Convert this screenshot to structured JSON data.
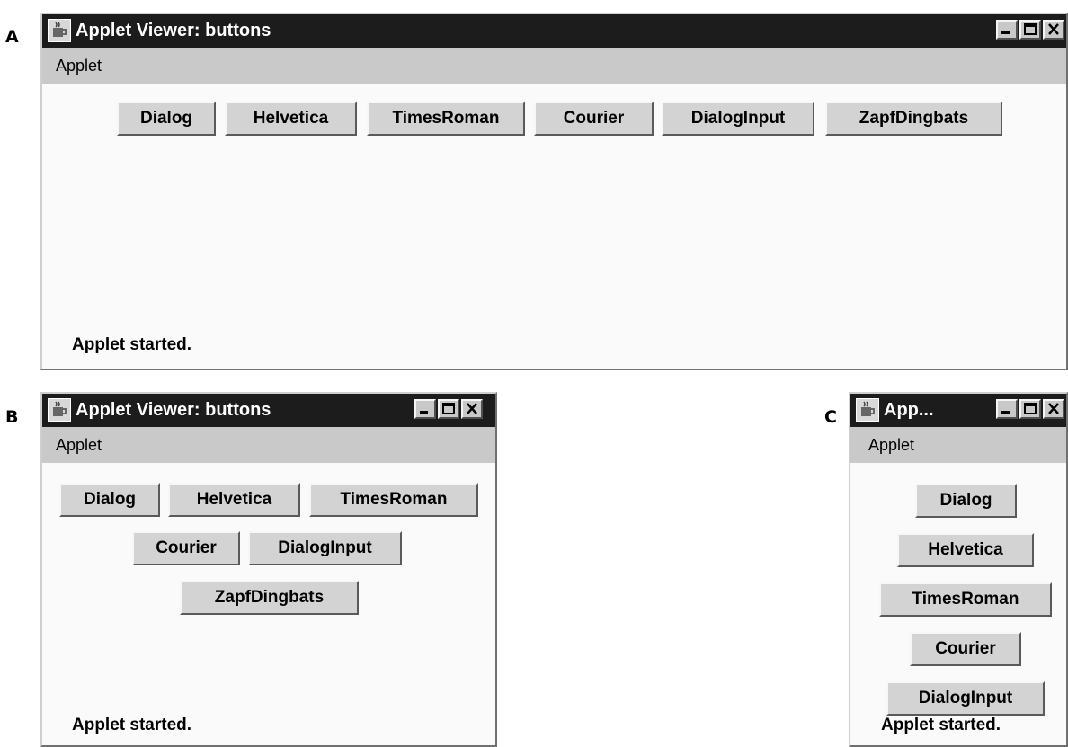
{
  "panel_labels": [
    "A",
    "B",
    "C"
  ],
  "windows": {
    "a": {
      "title": "Applet Viewer: buttons",
      "menu": "Applet",
      "status": "Applet started."
    },
    "b": {
      "title": "Applet Viewer: buttons",
      "menu": "Applet",
      "status": "Applet started."
    },
    "c": {
      "title": "App...",
      "menu": "Applet",
      "status": "Applet started."
    }
  },
  "buttons": [
    "Dialog",
    "Helvetica",
    "TimesRoman",
    "Courier",
    "DialogInput",
    "ZapfDingbats"
  ],
  "title_controls": [
    "minimize-icon",
    "maximize-icon",
    "close-icon"
  ],
  "colors": {
    "titlebar": "#1c1c1c",
    "menubar": "#c9c9c9",
    "button_face": "#d3d3d3",
    "content": "#fafafa"
  }
}
